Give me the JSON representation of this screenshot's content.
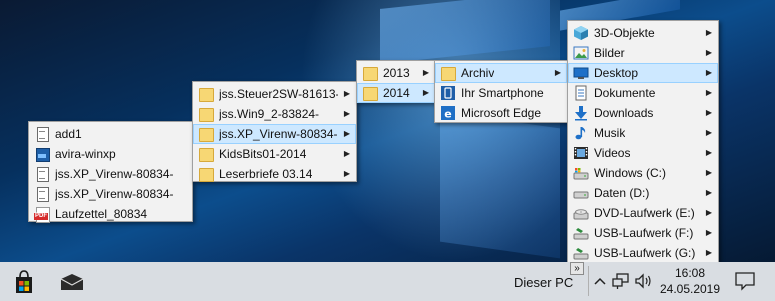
{
  "menus": {
    "recent_files": [
      {
        "label": "add1",
        "icon": "document-icon"
      },
      {
        "label": "avira-winxp",
        "icon": "image-file-icon"
      },
      {
        "label": "jss.XP_Virenw-80834-",
        "icon": "document-icon"
      },
      {
        "label": "jss.XP_Virenw-80834-",
        "icon": "document-icon"
      },
      {
        "label": "Laufzettel_80834",
        "icon": "pdf-icon"
      }
    ],
    "folders": [
      {
        "label": "jss.Steuer2SW-81613-"
      },
      {
        "label": "jss.Win9_2-83824-"
      },
      {
        "label": "jss.XP_Virenw-80834-",
        "selected": true
      },
      {
        "label": "KidsBits01-2014"
      },
      {
        "label": "Leserbriefe 03.14"
      }
    ],
    "years": [
      {
        "label": "2013"
      },
      {
        "label": "2014",
        "selected": true
      }
    ],
    "archive": [
      {
        "label": "Archiv",
        "selected": true,
        "has_submenu": true
      },
      {
        "label": "Ihr Smartphone",
        "has_submenu": false
      },
      {
        "label": "Microsoft Edge",
        "has_submenu": false
      }
    ],
    "this_pc": [
      {
        "label": "3D-Objekte",
        "icon": "3d-objects-icon"
      },
      {
        "label": "Bilder",
        "icon": "pictures-icon"
      },
      {
        "label": "Desktop",
        "icon": "desktop-icon",
        "selected": true
      },
      {
        "label": "Dokumente",
        "icon": "documents-icon"
      },
      {
        "label": "Downloads",
        "icon": "downloads-icon"
      },
      {
        "label": "Musik",
        "icon": "music-icon"
      },
      {
        "label": "Videos",
        "icon": "videos-icon"
      },
      {
        "label": "Windows (C:)",
        "icon": "drive-c-icon"
      },
      {
        "label": "Daten (D:)",
        "icon": "drive-d-icon"
      },
      {
        "label": "DVD-Laufwerk (E:)",
        "icon": "dvd-drive-icon"
      },
      {
        "label": "USB-Laufwerk (F:)",
        "icon": "usb-drive-icon"
      },
      {
        "label": "USB-Laufwerk (G:)",
        "icon": "usb-drive-icon"
      }
    ]
  },
  "taskbar": {
    "toolbar_label": "Dieser PC",
    "overflow_glyph": "»",
    "clock_time": "16:08",
    "clock_date": "24.05.2019"
  },
  "colors": {
    "menu_bg": "#f2f2f2",
    "selection": "#cde8ff",
    "taskbar": "#d9dde2"
  }
}
